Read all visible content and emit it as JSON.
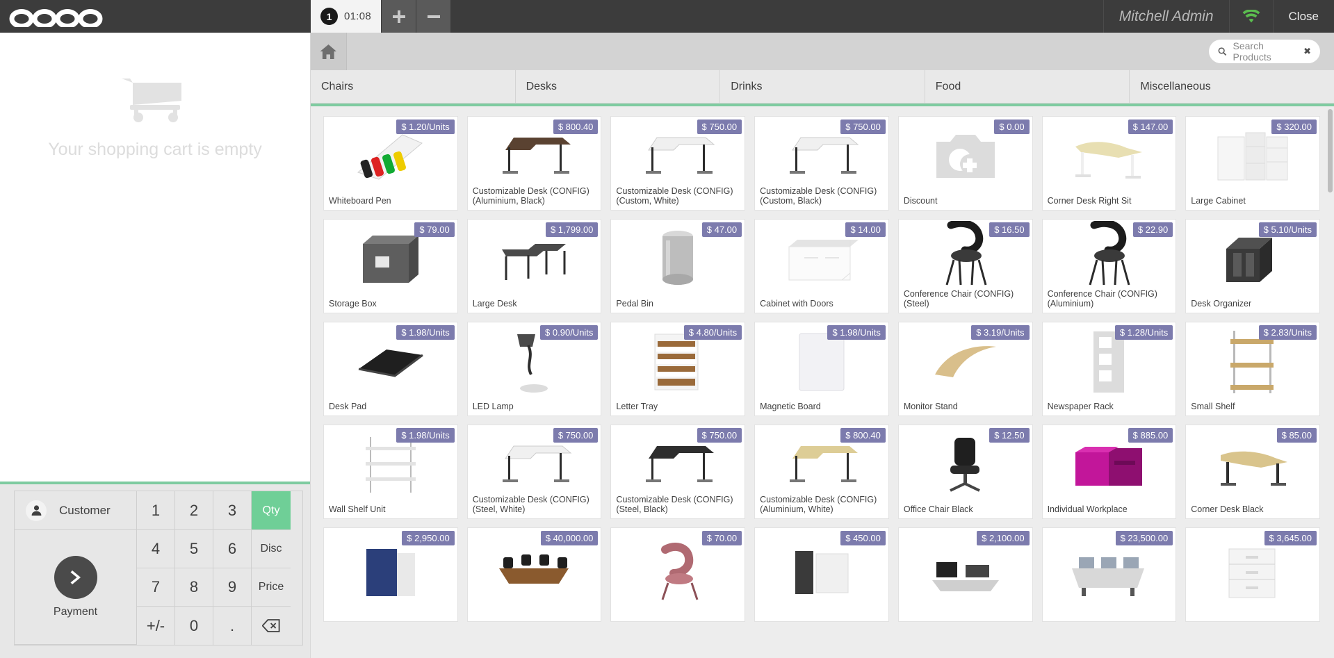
{
  "app": {
    "brand": "odoo"
  },
  "topbar": {
    "order": {
      "number": "1",
      "timer": "01:08"
    },
    "add_order_label": "+",
    "remove_order_label": "–",
    "username": "Mitchell Admin",
    "wifi_icon": "wifi-icon",
    "close_label": "Close"
  },
  "cart": {
    "empty_text": "Your shopping cart is empty",
    "icon": "shopping-cart-icon"
  },
  "numpad": {
    "customer_label": "Customer",
    "payment_label": "Payment",
    "keys": [
      "1",
      "2",
      "3",
      "4",
      "5",
      "6",
      "7",
      "8",
      "9",
      "+/-",
      "0",
      "."
    ],
    "modes": [
      {
        "label": "Qty",
        "active": true
      },
      {
        "label": "Disc",
        "active": false
      },
      {
        "label": "Price",
        "active": false
      }
    ],
    "backspace_icon": "backspace-icon",
    "accent_color": "#6fcf97"
  },
  "search": {
    "placeholder": "Search Products",
    "value": "",
    "icon": "search-icon",
    "clear_icon": "close-icon",
    "home_icon": "home-icon"
  },
  "categories": [
    {
      "label": "Chairs"
    },
    {
      "label": "Desks"
    },
    {
      "label": "Drinks"
    },
    {
      "label": "Food"
    },
    {
      "label": "Miscellaneous"
    }
  ],
  "products": [
    {
      "name": "Whiteboard Pen",
      "price": "$ 1.20/Units",
      "art": "pens"
    },
    {
      "name": "Customizable Desk (CONFIG) (Aluminium, Black)",
      "price": "$ 800.40",
      "art": "desk-dark"
    },
    {
      "name": "Customizable Desk (CONFIG) (Custom, White)",
      "price": "$ 750.00",
      "art": "desk-white"
    },
    {
      "name": "Customizable Desk (CONFIG) (Custom, Black)",
      "price": "$ 750.00",
      "art": "desk-white"
    },
    {
      "name": "Discount",
      "price": "$ 0.00",
      "art": "placeholder"
    },
    {
      "name": "Corner Desk Right Sit",
      "price": "$ 147.00",
      "art": "desk-corner"
    },
    {
      "name": "Large Cabinet",
      "price": "$ 320.00",
      "art": "cabinet"
    },
    {
      "name": "Storage Box",
      "price": "$ 79.00",
      "art": "box"
    },
    {
      "name": "Large Desk",
      "price": "$ 1,799.00",
      "art": "desk-large"
    },
    {
      "name": "Pedal Bin",
      "price": "$ 47.00",
      "art": "bin"
    },
    {
      "name": "Cabinet with Doors",
      "price": "$ 14.00",
      "art": "cabinet-doors"
    },
    {
      "name": "Conference Chair (CONFIG) (Steel)",
      "price": "$ 16.50",
      "art": "chair"
    },
    {
      "name": "Conference Chair (CONFIG) (Aluminium)",
      "price": "$ 22.90",
      "art": "chair"
    },
    {
      "name": "Desk Organizer",
      "price": "$ 5.10/Units",
      "art": "organizer"
    },
    {
      "name": "Desk Pad",
      "price": "$ 1.98/Units",
      "art": "pad"
    },
    {
      "name": "LED Lamp",
      "price": "$ 0.90/Units",
      "art": "lamp"
    },
    {
      "name": "Letter Tray",
      "price": "$ 4.80/Units",
      "art": "tray"
    },
    {
      "name": "Magnetic Board",
      "price": "$ 1.98/Units",
      "art": "board"
    },
    {
      "name": "Monitor Stand",
      "price": "$ 3.19/Units",
      "art": "stand"
    },
    {
      "name": "Newspaper Rack",
      "price": "$ 1.28/Units",
      "art": "rack"
    },
    {
      "name": "Small Shelf",
      "price": "$ 2.83/Units",
      "art": "shelf"
    },
    {
      "name": "Wall Shelf Unit",
      "price": "$ 1.98/Units",
      "art": "wallshelf"
    },
    {
      "name": "Customizable Desk (CONFIG) (Steel, White)",
      "price": "$ 750.00",
      "art": "desk-white"
    },
    {
      "name": "Customizable Desk (CONFIG) (Steel, Black)",
      "price": "$ 750.00",
      "art": "desk-black"
    },
    {
      "name": "Customizable Desk (CONFIG) (Aluminium, White)",
      "price": "$ 800.40",
      "art": "desk-beige"
    },
    {
      "name": "Office Chair Black",
      "price": "$ 12.50",
      "art": "officechair"
    },
    {
      "name": "Individual Workplace",
      "price": "$ 885.00",
      "art": "workplace"
    },
    {
      "name": "Corner Desk Black",
      "price": "$ 85.00",
      "art": "desk-corner-black"
    },
    {
      "name": "",
      "price": "$ 2,950.00",
      "art": "panel-blue"
    },
    {
      "name": "",
      "price": "$ 40,000.00",
      "art": "conference"
    },
    {
      "name": "",
      "price": "$ 70.00",
      "art": "chair-pink"
    },
    {
      "name": "",
      "price": "$ 450.00",
      "art": "divider"
    },
    {
      "name": "",
      "price": "$ 2,100.00",
      "art": "deskset"
    },
    {
      "name": "",
      "price": "$ 23,500.00",
      "art": "openspace"
    },
    {
      "name": "",
      "price": "$ 3,645.00",
      "art": "drawer"
    }
  ]
}
